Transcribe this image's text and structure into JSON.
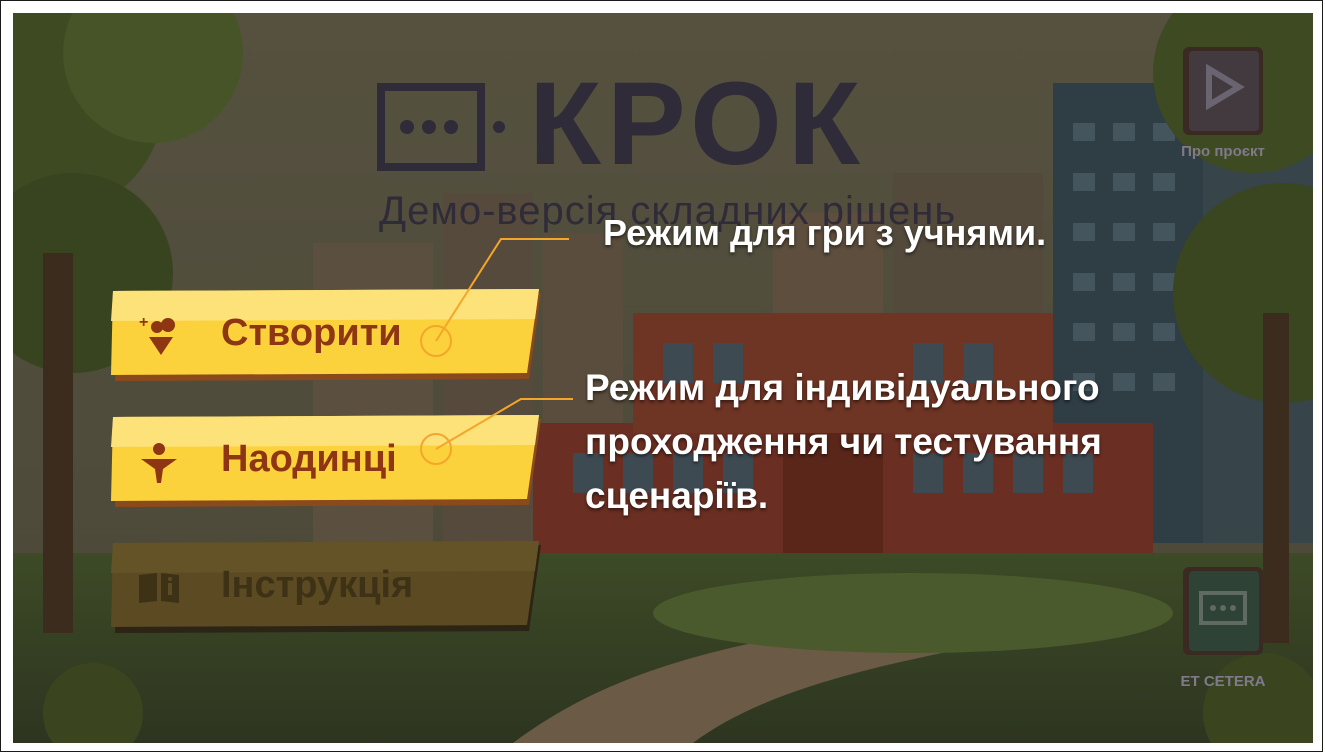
{
  "game": {
    "logo_title": "КРОК",
    "logo_subtitle": "Демо-версія складних рішень"
  },
  "menu": {
    "create_label": "Створити",
    "solo_label": "Наодинці",
    "instructions_label": "Інструкція"
  },
  "side": {
    "about_label": "Про проєкт",
    "etcetera_label": "ET CETERA"
  },
  "annotations": {
    "create_note": "Режим для гри з учнями.",
    "solo_note": "Режим для індивідуального проходження чи тестування сценаріїв."
  },
  "colors": {
    "button_yellow": "#fbd23c",
    "button_text": "#8e3513",
    "callout_line": "#f4a62a",
    "annotation_text": "#ffffff"
  }
}
